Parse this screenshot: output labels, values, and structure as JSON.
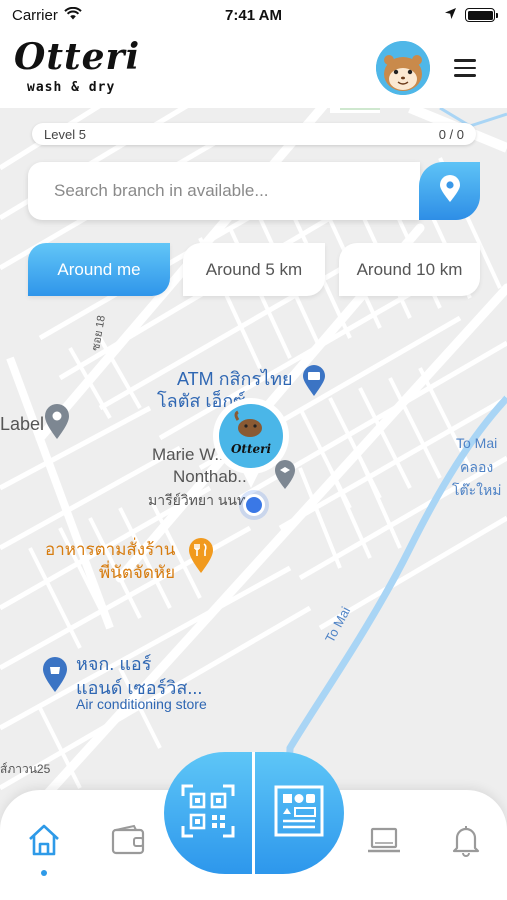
{
  "status_bar": {
    "carrier": "Carrier",
    "time": "7:41 AM",
    "battery_level": 1.0
  },
  "header": {
    "title": "Otteri",
    "subtitle": "wash & dry",
    "avatar": "hamster-avatar",
    "menu_icon": "hamburger-menu-icon"
  },
  "level": {
    "label": "Level 5",
    "progress": "0 / 0"
  },
  "search": {
    "placeholder": "Search branch in available...",
    "button_icon": "location-pin-icon"
  },
  "radius_chips": [
    {
      "label": "Around me",
      "active": true
    },
    {
      "label": "Around 5 km",
      "active": false
    },
    {
      "label": "Around 10 km",
      "active": false
    }
  ],
  "map": {
    "labels": {
      "atm_1": "ATM กสิกรไทย",
      "atm_2": "โลตัส เอ็กซ์...",
      "label_left": "Label",
      "marie_1": "Marie W...",
      "marie_2": "Nonthab...",
      "marie_3": "มารีย์วิทยา นนท...",
      "food_1": "อาหารตามสั่งร้าน",
      "food_2": "พี่นัตจัดหัย",
      "aircon_1": "หจก. แอร์",
      "aircon_2": "แอนด์ เซอร์วิส...",
      "aircon_3": "Air conditioning store",
      "canal_1": "To Mai",
      "canal_2": "คลอง",
      "canal_3": "โต๊ะใหม่",
      "canal_road": "To Mai",
      "soi_top": "ซอย 18",
      "soi_bottom": "ส์ภาวน25"
    },
    "accent_color": "#2e9ae8"
  },
  "bottom_nav": {
    "items": [
      "home-icon",
      "wallet-icon",
      "qr-scan-icon",
      "menu-board-icon",
      "laptop-icon",
      "bell-icon"
    ],
    "active": "home-icon"
  }
}
